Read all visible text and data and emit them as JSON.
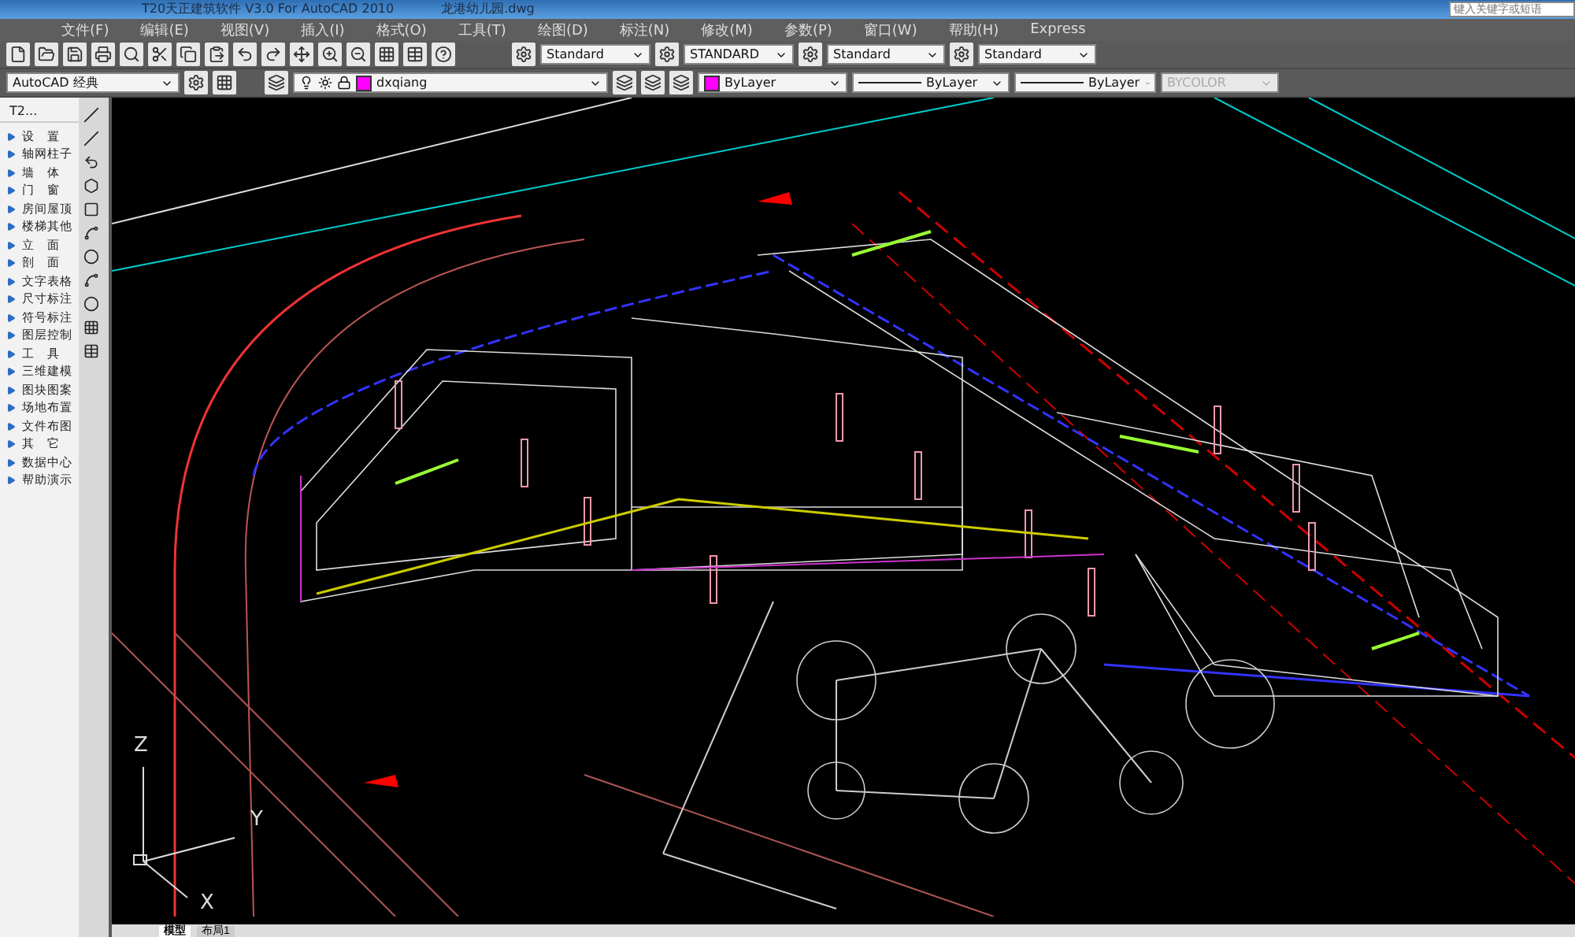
{
  "window": {
    "title": "T20天正建筑软件 V3.0 For AutoCAD 2010",
    "file": "龙港幼儿园.dwg",
    "search": {
      "placeholder": "键入关键字或短语"
    }
  },
  "menu": [
    "文件(F)",
    "编辑(E)",
    "视图(V)",
    "插入(I)",
    "格式(O)",
    "工具(T)",
    "绘图(D)",
    "标注(N)",
    "修改(M)",
    "参数(P)",
    "窗口(W)",
    "帮助(H)",
    "Express"
  ],
  "styles": [
    {
      "value": "Standard"
    },
    {
      "value": "STANDARD"
    },
    {
      "value": "Standard"
    },
    {
      "value": "Standard"
    }
  ],
  "properties": {
    "workspace": "AutoCAD 经典",
    "layer": {
      "name": "dxqiang",
      "color": "#ff00ff"
    },
    "color": {
      "value": "ByLayer",
      "color": "#ff00ff"
    },
    "linetype": "ByLayer",
    "lineweight": "ByLayer",
    "plot_style": {
      "value": "BYCOLOR",
      "disabled": true
    }
  },
  "palette": {
    "title": "T2...",
    "items": [
      {
        "label": "设　置"
      },
      {
        "label": "轴网柱子"
      },
      {
        "label": "墙　体"
      },
      {
        "label": "门　窗"
      },
      {
        "label": "房间屋顶"
      },
      {
        "label": "楼梯其他"
      },
      {
        "label": "立　面"
      },
      {
        "label": "剖　面"
      },
      {
        "label": "文字表格"
      },
      {
        "label": "尺寸标注"
      },
      {
        "label": "符号标注"
      },
      {
        "label": "图层控制"
      },
      {
        "label": "工　具"
      },
      {
        "label": "三维建模"
      },
      {
        "label": "图块图案"
      },
      {
        "label": "场地布置"
      },
      {
        "label": "文件布图"
      },
      {
        "label": "其　它"
      },
      {
        "label": "数据中心"
      },
      {
        "label": "帮助演示"
      }
    ]
  },
  "viewport": {
    "axis_labels": [
      "Z",
      "Y",
      "X"
    ]
  },
  "layout_tabs": [
    {
      "label": "模型",
      "selected": true
    },
    {
      "label": "布局1",
      "selected": false
    }
  ]
}
